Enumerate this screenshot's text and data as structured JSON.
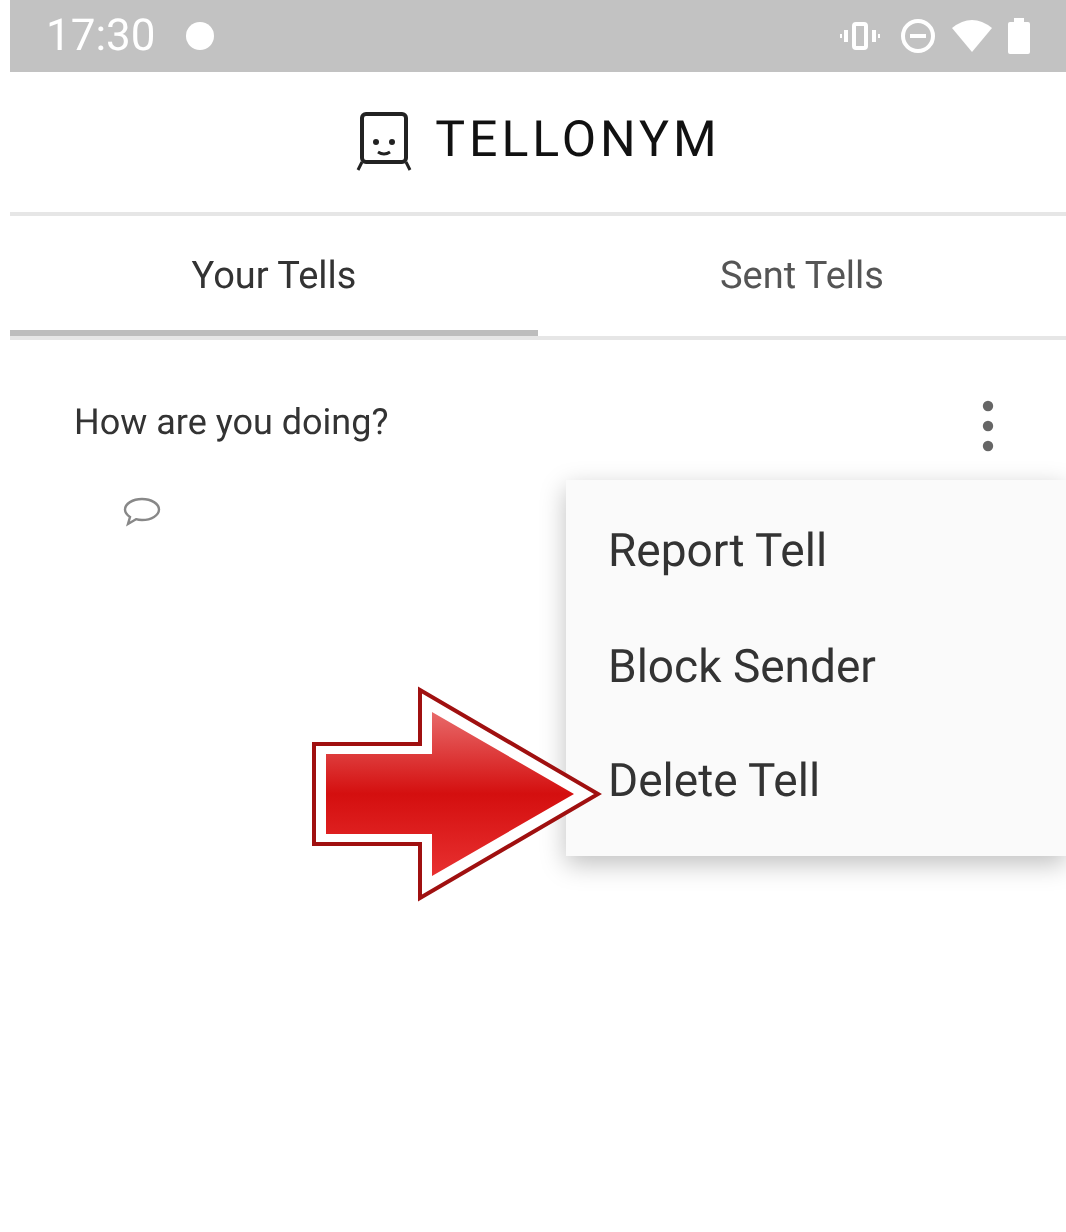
{
  "status_bar": {
    "time": "17:30"
  },
  "header": {
    "title": "TELLONYM"
  },
  "tabs": [
    {
      "label": "Your Tells",
      "selected": true
    },
    {
      "label": "Sent Tells",
      "selected": false
    }
  ],
  "tells": [
    {
      "text": "How are you doing?"
    }
  ],
  "menu": {
    "items": [
      {
        "label": "Report Tell"
      },
      {
        "label": "Block Sender"
      },
      {
        "label": "Delete Tell"
      }
    ]
  }
}
